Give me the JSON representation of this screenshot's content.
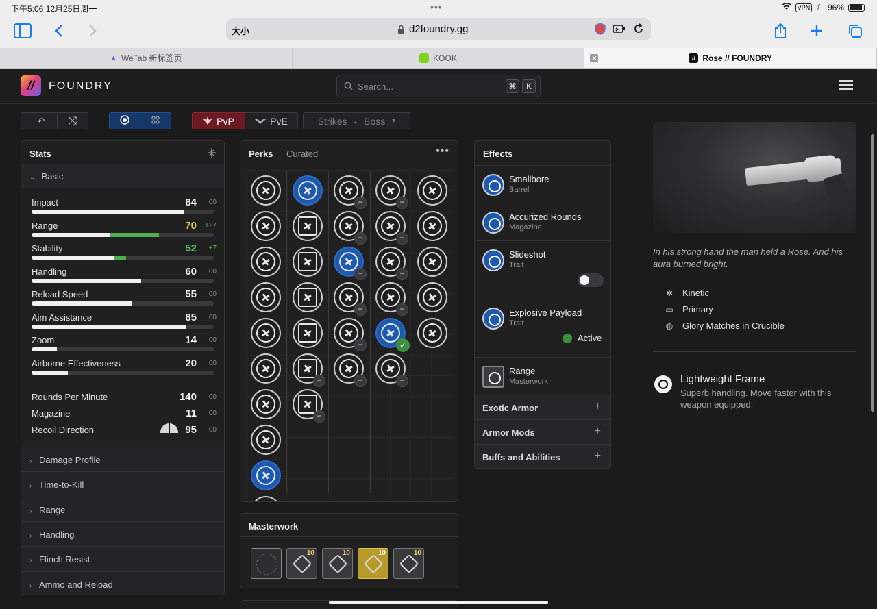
{
  "status_bar": {
    "time_date": "下午5:06 12月25日周一",
    "dots": "•••",
    "vpn": "VPN",
    "battery": "96%"
  },
  "browser": {
    "text_size_label": "大小",
    "url": "d2foundry.gg",
    "tabs": [
      {
        "label": "WeTab 新标签页"
      },
      {
        "label": "KOOK"
      },
      {
        "label": "Rose // FOUNDRY"
      }
    ]
  },
  "site": {
    "logo_text": "//",
    "brand": "FOUNDRY",
    "search": {
      "placeholder": "Search...",
      "key1": "⌘",
      "key2": "K"
    }
  },
  "controls": {
    "undo": "↶",
    "shuffle": "⤭",
    "pvp_label": "PvP",
    "pve_label": "PvE",
    "activity": "Strikes",
    "activity_sep": "-",
    "activity_detail": "Boss",
    "dropdown_caret": "▾"
  },
  "stats": {
    "title": "Stats",
    "basic_header": "Basic",
    "bar_stats": [
      {
        "name": "Impact",
        "value": "84",
        "bonus": "00",
        "base": 84,
        "boost": 0,
        "color": "white"
      },
      {
        "name": "Range",
        "value": "70",
        "bonus": "+27",
        "base": 43,
        "boost": 27,
        "color": "yellow"
      },
      {
        "name": "Stability",
        "value": "52",
        "bonus": "+7",
        "base": 45,
        "boost": 7,
        "color": "green"
      },
      {
        "name": "Handling",
        "value": "60",
        "bonus": "00",
        "base": 60,
        "boost": 0,
        "color": "white"
      },
      {
        "name": "Reload Speed",
        "value": "55",
        "bonus": "00",
        "base": 55,
        "boost": 0,
        "color": "white"
      },
      {
        "name": "Aim Assistance",
        "value": "85",
        "bonus": "00",
        "base": 85,
        "boost": 0,
        "color": "white"
      },
      {
        "name": "Zoom",
        "value": "14",
        "bonus": "00",
        "base": 14,
        "boost": 0,
        "color": "white"
      },
      {
        "name": "Airborne Effectiveness",
        "value": "20",
        "bonus": "00",
        "base": 20,
        "boost": 0,
        "color": "white"
      }
    ],
    "plain_stats": [
      {
        "name": "Rounds Per Minute",
        "value": "140",
        "bonus": "00"
      },
      {
        "name": "Magazine",
        "value": "11",
        "bonus": "00"
      },
      {
        "name": "Recoil Direction",
        "value": "95",
        "bonus": "00"
      }
    ],
    "sections": [
      "Damage Profile",
      "Time-to-Kill",
      "Range",
      "Handling",
      "Flinch Resist",
      "Ammo and Reload"
    ]
  },
  "perks": {
    "tab_perks": "Perks",
    "tab_curated": "Curated",
    "more": "•••",
    "columns": [
      {
        "count": 10,
        "selected": [
          8
        ]
      },
      {
        "count": 7,
        "selected": [
          0
        ]
      },
      {
        "count": 6,
        "selected": [
          2
        ]
      },
      {
        "count": 6,
        "selected": [
          4
        ]
      },
      {
        "count": 5,
        "selected": []
      }
    ],
    "minus_label": "−",
    "check_label": "✓"
  },
  "masterwork": {
    "title": "Masterwork",
    "slots": [
      {
        "level": "",
        "state": "empty"
      },
      {
        "level": "10",
        "state": "normal"
      },
      {
        "level": "10",
        "state": "normal"
      },
      {
        "level": "10",
        "state": "selected"
      },
      {
        "level": "10",
        "state": "normal"
      }
    ]
  },
  "effects": {
    "title": "Effects",
    "items": [
      {
        "name": "Smallbore",
        "sub": "Barrel"
      },
      {
        "name": "Accurized Rounds",
        "sub": "Magazine"
      },
      {
        "name": "Slideshot",
        "sub": "Trait"
      },
      {
        "name": "Explosive Payload",
        "sub": "Trait",
        "status": "Active"
      },
      {
        "name": "Range",
        "sub": "Masterwork"
      }
    ],
    "accordions": [
      {
        "label": "Exotic Armor",
        "icon": "+"
      },
      {
        "label": "Armor Mods",
        "icon": "+"
      },
      {
        "label": "Buffs and Abilities",
        "icon": "+"
      }
    ]
  },
  "weapon": {
    "flavor": "In his strong hand the man held a Rose. And his aura burned bright.",
    "element": "Kinetic",
    "slot": "Primary",
    "source": "Glory Matches in Crucible",
    "frame_name": "Lightweight Frame",
    "frame_desc": "Superb handling. Move faster with this weapon equipped."
  },
  "colors": {
    "accent_blue": "#1e59b0",
    "pvp_red": "#6b1a22",
    "bonus_yellow": "#e8c33a",
    "bonus_green": "#5cc15f"
  }
}
